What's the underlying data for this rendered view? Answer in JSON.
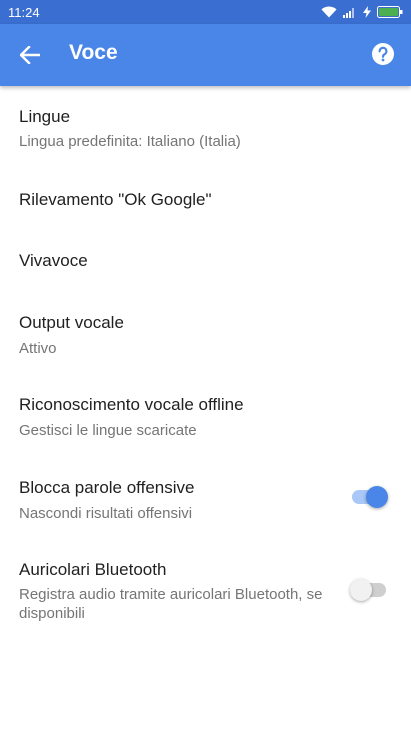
{
  "status_bar": {
    "time": "11:24",
    "icons": [
      "wifi-icon",
      "signal-icon",
      "charging-icon",
      "battery-icon"
    ],
    "battery_color": "#4caf50"
  },
  "app_bar": {
    "title": "Voce",
    "back_icon": "arrow-left-icon",
    "help_icon": "help-icon",
    "color": "#4a86e8"
  },
  "settings": [
    {
      "title": "Lingue",
      "subtitle": "Lingua predefinita: Italiano (Italia)"
    },
    {
      "title": "Rilevamento \"Ok Google\""
    },
    {
      "title": "Vivavoce"
    },
    {
      "title": "Output vocale",
      "subtitle": "Attivo"
    },
    {
      "title": "Riconoscimento vocale offline",
      "subtitle": "Gestisci le lingue scaricate"
    },
    {
      "title": "Blocca parole offensive",
      "subtitle": "Nascondi risultati offensivi",
      "toggle": true
    },
    {
      "title": "Auricolari Bluetooth",
      "subtitle": "Registra audio tramite auricolari Bluetooth, se disponibili",
      "toggle": false
    }
  ]
}
